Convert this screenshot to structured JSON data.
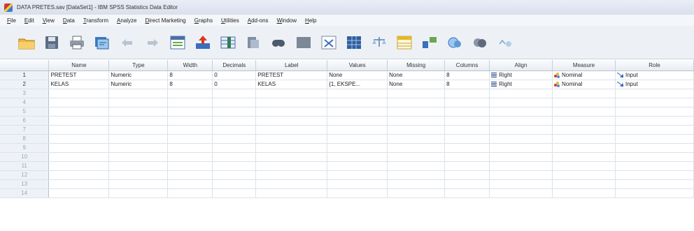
{
  "window": {
    "title": "DATA PRETES.sav [DataSet1] - IBM SPSS Statistics Data Editor"
  },
  "menu": [
    "File",
    "Edit",
    "View",
    "Data",
    "Transform",
    "Analyze",
    "Direct Marketing",
    "Graphs",
    "Utilities",
    "Add-ons",
    "Window",
    "Help"
  ],
  "toolbar": {
    "icons": [
      "open-folder-icon",
      "save-icon",
      "print-icon",
      "dialog-recall-icon",
      "undo-icon",
      "redo-icon",
      "goto-case-icon",
      "goto-variable-icon",
      "variables-icon",
      "run-descriptives-icon",
      "find-icon",
      "insert-cases-icon",
      "insert-variable-icon",
      "split-file-icon",
      "weight-cases-icon",
      "select-cases-icon",
      "value-labels-icon",
      "use-variable-sets-icon",
      "show-all-variables-icon",
      "spelling-icon"
    ]
  },
  "grid": {
    "columns": [
      "Name",
      "Type",
      "Width",
      "Decimals",
      "Label",
      "Values",
      "Missing",
      "Columns",
      "Align",
      "Measure",
      "Role"
    ],
    "rows": [
      {
        "num": "1",
        "name": "PRETEST",
        "type": "Numeric",
        "width": "8",
        "decimals": "0",
        "label": "PRETEST",
        "values": "None",
        "missing": "None",
        "columns": "8",
        "align": "Right",
        "measure": "Nominal",
        "role": "Input"
      },
      {
        "num": "2",
        "name": "KELAS",
        "type": "Numeric",
        "width": "8",
        "decimals": "0",
        "label": "KELAS",
        "values": "{1, EKSPE...",
        "missing": "None",
        "columns": "8",
        "align": "Right",
        "measure": "Nominal",
        "role": "Input"
      }
    ],
    "empty_rows": [
      "3",
      "4",
      "5",
      "6",
      "7",
      "8",
      "9",
      "10",
      "11",
      "12",
      "13",
      "14"
    ]
  }
}
